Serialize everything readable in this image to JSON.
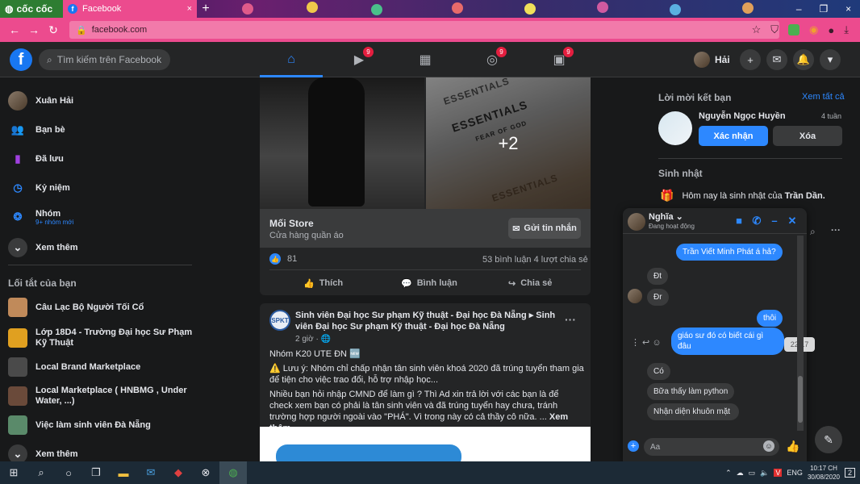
{
  "browser": {
    "brand_label": "cốc cốc",
    "active_tab_title": "Facebook",
    "tab_close": "×",
    "new_tab": "+",
    "url": "facebook.com",
    "window_controls": [
      "–",
      "❐",
      "×"
    ]
  },
  "header": {
    "search_placeholder": "Tìm kiếm trên Facebook",
    "nav": [
      {
        "name": "home",
        "active": true,
        "badge": ""
      },
      {
        "name": "watch",
        "active": false,
        "badge": "9"
      },
      {
        "name": "marketplace",
        "active": false,
        "badge": ""
      },
      {
        "name": "groups",
        "active": false,
        "badge": "9"
      },
      {
        "name": "gaming",
        "active": false,
        "badge": "9"
      }
    ],
    "profile_name": "Hải"
  },
  "left_sidebar": {
    "items": [
      {
        "label": "Xuân Hải",
        "icon": "avatar"
      },
      {
        "label": "Bạn bè",
        "icon": "friends-icon"
      },
      {
        "label": "Đã lưu",
        "icon": "bookmark-icon"
      },
      {
        "label": "Kỷ niệm",
        "icon": "clock-icon"
      },
      {
        "label": "Nhóm",
        "icon": "groups-icon",
        "sub": "9+ nhóm mới"
      },
      {
        "label": "Xem thêm",
        "icon": "chevron-down-icon"
      }
    ],
    "shortcuts_heading": "Lối tắt của bạn",
    "shortcuts": [
      "Câu Lạc Bộ Người Tối Cổ",
      "Lớp 18D4 - Trường Đại học Sư Phạm Kỹ Thuật",
      "Local Brand Marketplace",
      "Local Marketplace ( HNBMG , Under Water, ...)",
      "Việc làm sinh viên Đà Nẵng",
      "Xem thêm"
    ]
  },
  "feed": {
    "post1": {
      "image_text": "ESSENTIALS",
      "image_subtext": "FEAR OF GOD",
      "more_images": "+2",
      "store_name": "Mối Store",
      "store_category": "Cửa hàng quần áo",
      "message_button": "Gửi tin nhắn",
      "likes": "81",
      "comments_shares": "53 bình luận  4 lượt chia sẻ",
      "actions": [
        "Thích",
        "Bình luận",
        "Chia sẻ"
      ]
    },
    "post2": {
      "logo_text": "SPKT",
      "title": "Sinh viên Đại học Sư phạm Kỹ thuật - Đại học Đà Nẵng ▸ Sinh viên Đại học Sư phạm Kỹ thuật - Đại học Đà Nẵng",
      "time": "2 giờ · 🌐",
      "line1": "Nhóm K20 UTE ĐN 🆕",
      "line2": "⚠️ Lưu ý: Nhóm chỉ chấp nhận tân sinh viên khoá 2020 đã trúng tuyển tham gia để tiện cho việc trao đổi, hỗ trợ nhập học...",
      "line3": "Nhiều bạn hỏi nhập CMND để làm gì ? Thì Ad xin trả lời với các bạn là để check xem bạn có phải là tân sinh viên và đã trúng tuyển hay chưa, tránh trường hợp người ngoài vào \"PHÁ\". Vì trong này có cả thầy cô nữa. ...",
      "see_more": "Xem thêm"
    }
  },
  "right_sidebar": {
    "friend_requests_heading": "Lời mời kết bạn",
    "see_all": "Xem tất cả",
    "request_name": "Nguyễn Ngọc Huyền",
    "request_time": "4 tuần",
    "confirm": "Xác nhận",
    "delete": "Xóa",
    "birthday_heading": "Sinh nhật",
    "birthday_text": "Hôm nay là sinh nhật của",
    "birthday_name": "Trần Dần."
  },
  "chat": {
    "name": "Nghĩa",
    "status": "Đang hoạt động",
    "messages": [
      {
        "from": "me",
        "text": "Trần Viết Minh Phát á hả?"
      },
      {
        "from": "them",
        "text": "Đt"
      },
      {
        "from": "them",
        "text": "Đr"
      },
      {
        "from": "me",
        "text": "thôi"
      },
      {
        "from": "me",
        "text": "giáo sư đó có biết cái gì đâu"
      },
      {
        "from": "them",
        "text": "Có"
      },
      {
        "from": "them",
        "text": "Bữa thấy làm python"
      },
      {
        "from": "them",
        "text": "Nhận diện khuôn mặt"
      }
    ],
    "tooltip_time": "22:17",
    "input_placeholder": "Aa"
  },
  "taskbar": {
    "lang": "ENG",
    "time": "10:17 CH",
    "date": "30/08/2020",
    "notif_count": "2"
  },
  "colors": {
    "fb_blue": "#1877f2",
    "accent": "#2d88ff",
    "browser_pink": "#ec4b8e",
    "fb_dark": "#242526"
  }
}
